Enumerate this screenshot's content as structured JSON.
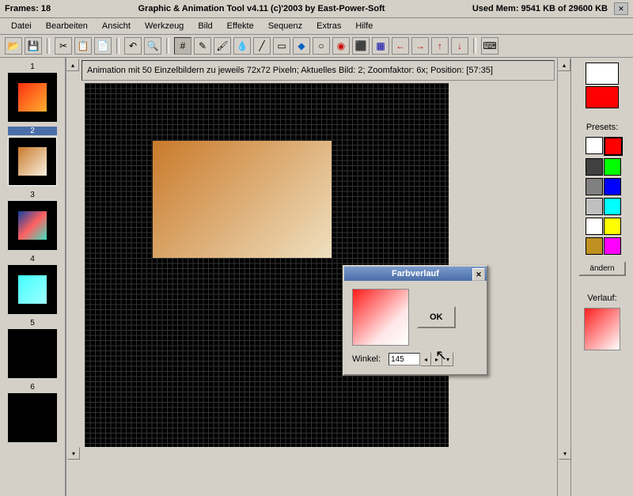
{
  "titlebar": {
    "frames_label": "Frames: 18",
    "app_title": "Graphic & Animation Tool v4.11 (c)'2003 by East-Power-Soft",
    "mem_label": "Used Mem: 9541 KB of 29600 KB"
  },
  "menu": {
    "datei": "Datei",
    "bearbeiten": "Bearbeiten",
    "ansicht": "Ansicht",
    "werkzeug": "Werkzeug",
    "bild": "Bild",
    "effekte": "Effekte",
    "sequenz": "Sequenz",
    "extras": "Extras",
    "hilfe": "Hilfe"
  },
  "statusbar": {
    "text": "Animation mit 50 Einzelbildern zu jeweils 72x72 Pixeln;   Aktuelles Bild: 2;   Zoomfaktor: 6x;   Position: [57:35]"
  },
  "frames": {
    "f1": "1",
    "f2": "2",
    "f3": "3",
    "f4": "4",
    "f5": "5",
    "f6": "6"
  },
  "dialog": {
    "title": "Farbverlauf",
    "ok": "OK",
    "angle_label": "Winkel:",
    "angle_value": "145"
  },
  "right": {
    "presets_label": "Presets:",
    "change_btn": "ändern",
    "verlauf_label": "Verlauf:"
  },
  "colors": {
    "fg": "#ffffff",
    "bg": "#ff0000",
    "presets": [
      "#ffffff",
      "#ff0000",
      "#404040",
      "#00ff00",
      "#808080",
      "#0000ff",
      "#c0c0c0",
      "#00ffff",
      "#ffff00",
      "#ffff00",
      "#c09020",
      "#ff00ff"
    ]
  }
}
